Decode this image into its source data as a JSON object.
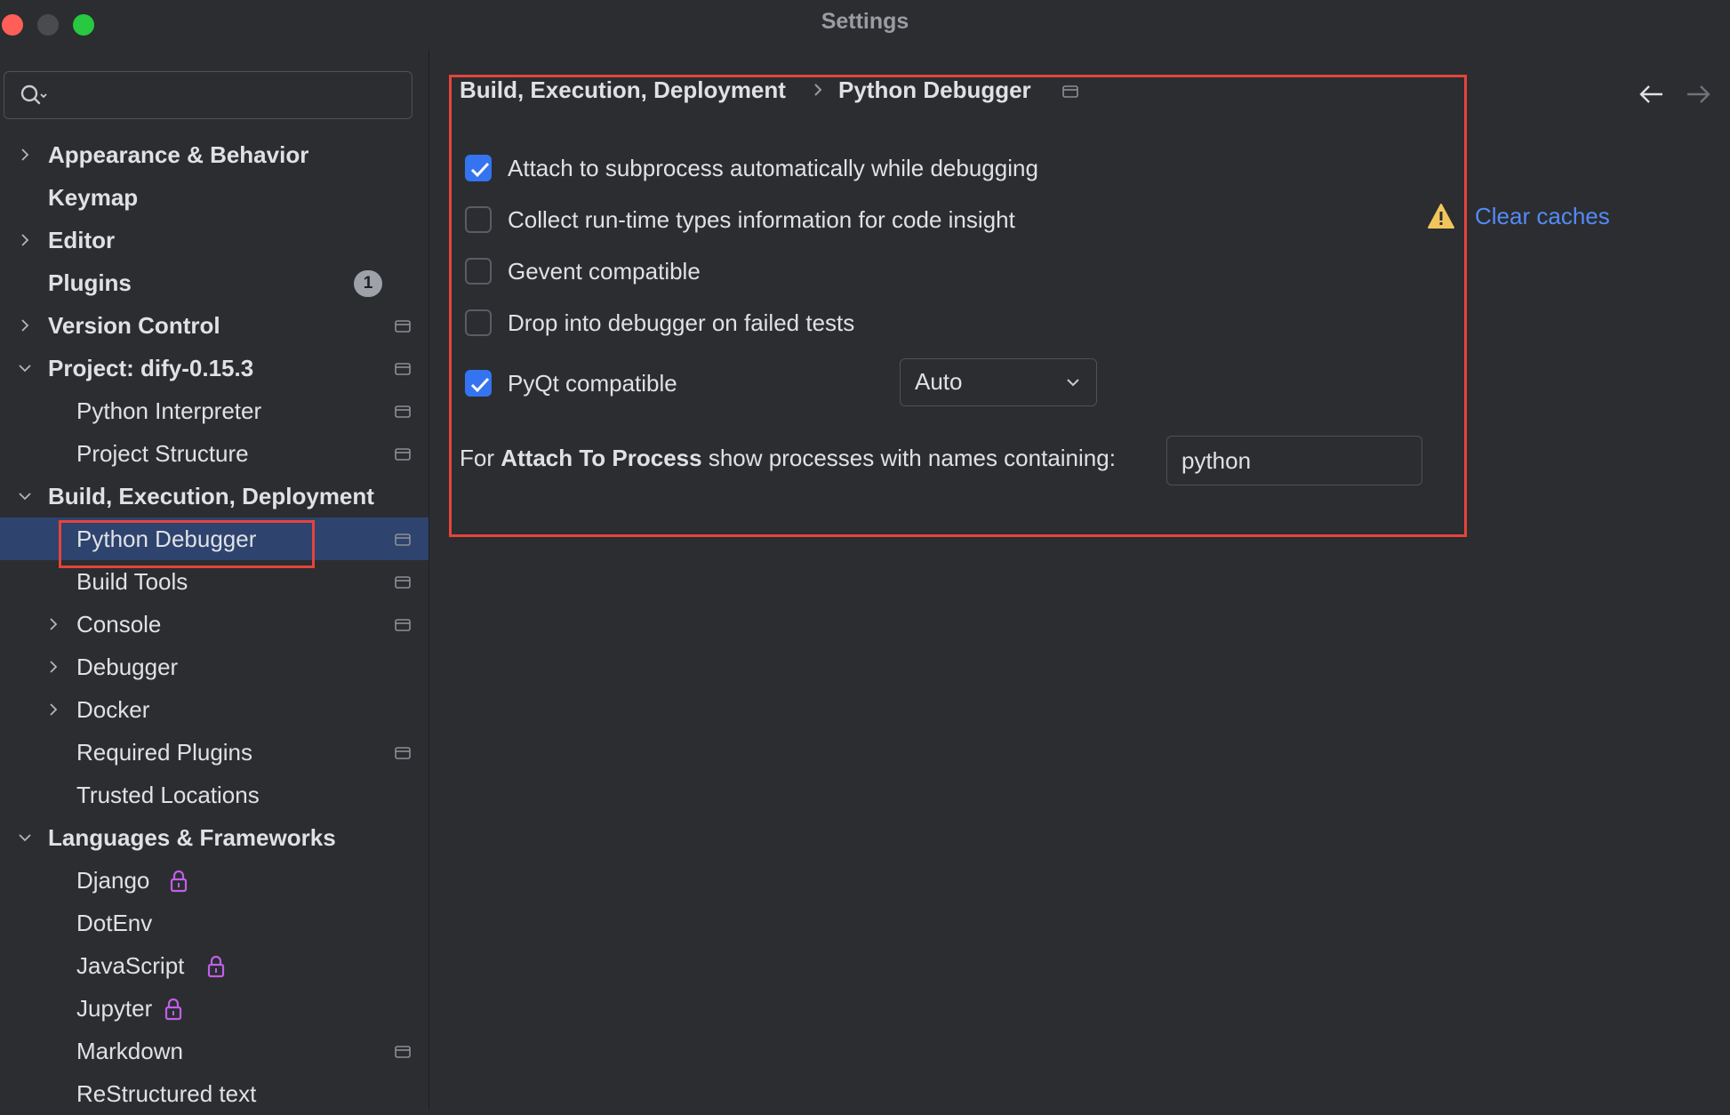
{
  "window": {
    "title": "Settings"
  },
  "search": {
    "value": ""
  },
  "tree": [
    {
      "label": "Appearance & Behavior",
      "bold": true,
      "level": 0,
      "expander": "collapsed",
      "pin": false
    },
    {
      "label": "Keymap",
      "bold": true,
      "level": 0,
      "expander": "none",
      "pin": false
    },
    {
      "label": "Editor",
      "bold": true,
      "level": 0,
      "expander": "collapsed",
      "pin": false
    },
    {
      "label": "Plugins",
      "bold": true,
      "level": 0,
      "expander": "none",
      "pin": false,
      "badge": "1"
    },
    {
      "label": "Version Control",
      "bold": true,
      "level": 0,
      "expander": "collapsed",
      "pin": true
    },
    {
      "label": "Project: dify-0.15.3",
      "bold": true,
      "level": 0,
      "expander": "expanded",
      "pin": true
    },
    {
      "label": "Python Interpreter",
      "bold": false,
      "level": 1,
      "expander": "none",
      "pin": true
    },
    {
      "label": "Project Structure",
      "bold": false,
      "level": 1,
      "expander": "none",
      "pin": true
    },
    {
      "label": "Build, Execution, Deployment",
      "bold": true,
      "level": 0,
      "expander": "expanded",
      "pin": false
    },
    {
      "label": "Python Debugger",
      "bold": false,
      "level": 1,
      "expander": "none",
      "pin": true,
      "selected": true
    },
    {
      "label": "Build Tools",
      "bold": false,
      "level": 1,
      "expander": "none",
      "pin": true
    },
    {
      "label": "Console",
      "bold": false,
      "level": 1,
      "expander": "collapsed",
      "pin": true
    },
    {
      "label": "Debugger",
      "bold": false,
      "level": 1,
      "expander": "collapsed",
      "pin": false
    },
    {
      "label": "Docker",
      "bold": false,
      "level": 1,
      "expander": "collapsed",
      "pin": false
    },
    {
      "label": "Required Plugins",
      "bold": false,
      "level": 1,
      "expander": "none",
      "pin": true
    },
    {
      "label": "Trusted Locations",
      "bold": false,
      "level": 1,
      "expander": "none",
      "pin": false
    },
    {
      "label": "Languages & Frameworks",
      "bold": true,
      "level": 0,
      "expander": "expanded",
      "pin": false
    },
    {
      "label": "Django",
      "bold": false,
      "level": 1,
      "expander": "none",
      "pin": false,
      "lock": true
    },
    {
      "label": "DotEnv",
      "bold": false,
      "level": 1,
      "expander": "none",
      "pin": false
    },
    {
      "label": "JavaScript",
      "bold": false,
      "level": 1,
      "expander": "none",
      "pin": false,
      "lock": true
    },
    {
      "label": "Jupyter",
      "bold": false,
      "level": 1,
      "expander": "none",
      "pin": false,
      "lock": true
    },
    {
      "label": "Markdown",
      "bold": false,
      "level": 1,
      "expander": "none",
      "pin": true
    },
    {
      "label": "ReStructured text",
      "bold": false,
      "level": 1,
      "expander": "none",
      "pin": false
    }
  ],
  "breadcrumb": {
    "parent": "Build, Execution, Deployment",
    "current": "Python Debugger"
  },
  "options": {
    "attach_subprocess": {
      "label": "Attach to subprocess automatically while debugging",
      "checked": true
    },
    "collect_types": {
      "label": "Collect run-time types information for code insight",
      "checked": false
    },
    "gevent": {
      "label": "Gevent compatible",
      "checked": false
    },
    "drop_into_debugger": {
      "label": "Drop into debugger on failed tests",
      "checked": false
    },
    "pyqt": {
      "label": "PyQt compatible",
      "checked": true,
      "mode": "Auto"
    }
  },
  "clear_caches": "Clear caches",
  "attach_to_process": {
    "prefix": "For ",
    "bold": "Attach To Process",
    "suffix": " show processes with names containing:",
    "value": "python"
  },
  "colors": {
    "accent": "#3574f0",
    "link": "#548af7",
    "highlight": "#e5443b",
    "lock": "#c05fe8",
    "warning": "#f2c55c"
  }
}
